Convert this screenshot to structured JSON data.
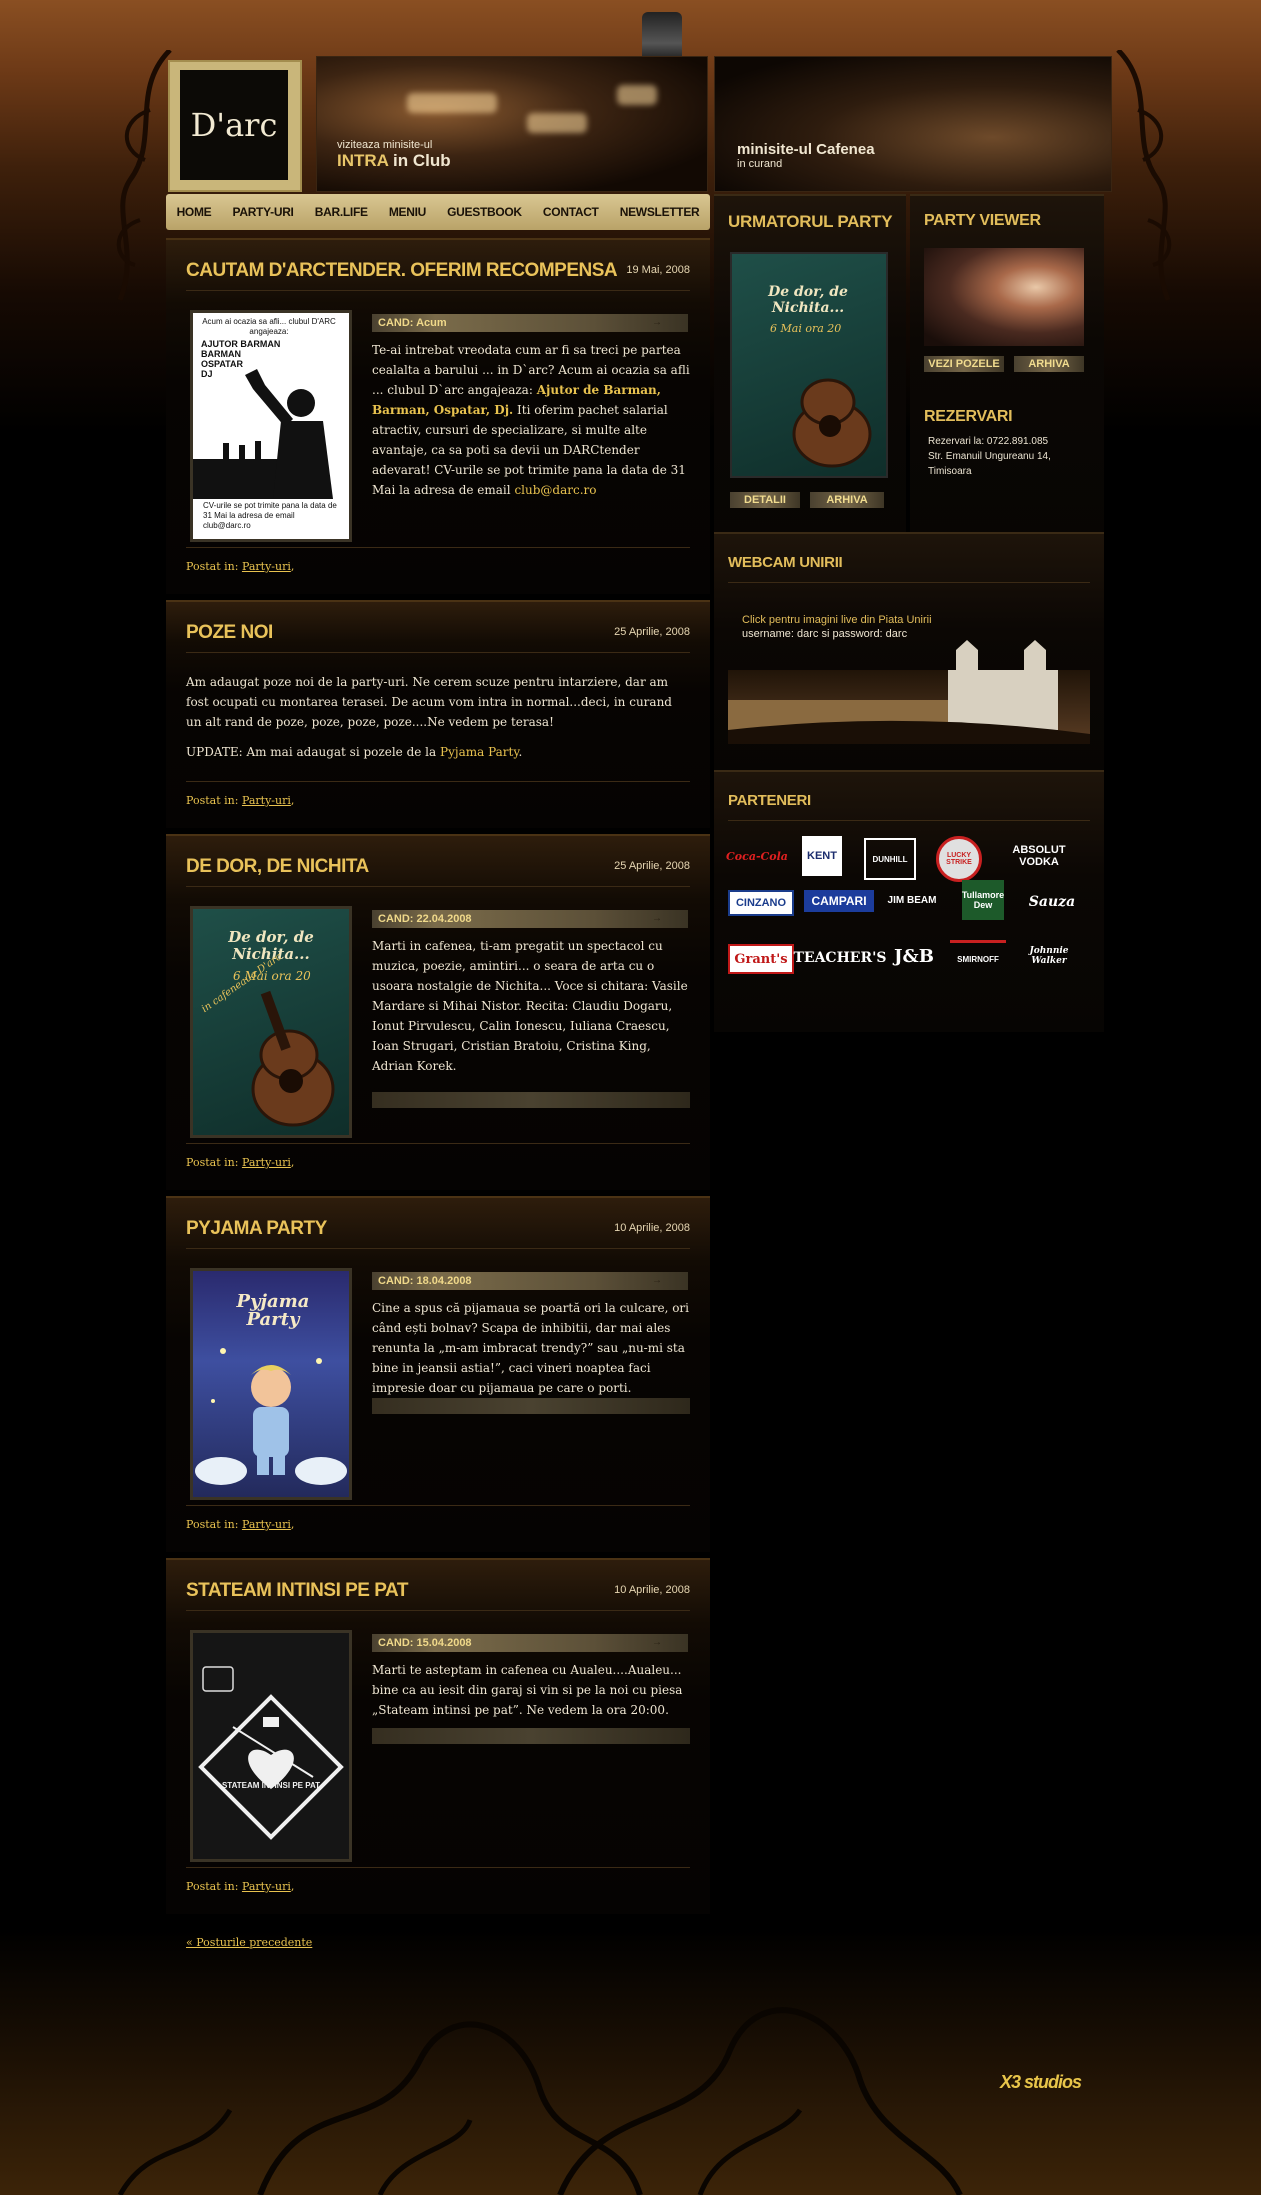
{
  "header": {
    "logo_text": "D'arc",
    "promo1_small": "viziteaza minisite-ul",
    "promo1_big": "INTRA",
    "promo1_suffix": "in Club",
    "promo2_big": "minisite-ul Cafenea",
    "promo2_small": "in curand"
  },
  "nav": [
    "HOME",
    "PARTY-URI",
    "BAR.LIFE",
    "MENIU",
    "GUESTBOOK",
    "CONTACT",
    "NEWSLETTER"
  ],
  "posts": [
    {
      "title": "CAUTAM D'ARCTENDER. OFERIM RECOMPENSA",
      "date": "19 Mai, 2008",
      "when": "CAND: Acum",
      "body_prefix": "Te-ai intrebat vreodata cum ar fi sa treci pe partea cealalta a barului ... in D`arc? Acum ai ocazia sa afli ... clubul D`arc angajeaza:",
      "body_bold": "Ajutor de Barman, Barman, Ospatar, Dj.",
      "body_suffix": "Iti oferim pachet salarial atractiv, cursuri de specializare, si multe alte avantaje, ca sa poti sa devii un DARCtender adevarat! CV-urile se pot trimite pana la data de 31 Mai la adresa de email",
      "email": "club@darc.ro",
      "poster_top": "Acum ai ocazia sa afli... clubul D'ARC angajeaza:",
      "poster_roles": [
        "AJUTOR BARMAN",
        "BARMAN",
        "OSPATAR",
        "DJ"
      ],
      "poster_bottom": "CV-urile se pot trimite pana la data de 31 Mai la adresa de email club@darc.ro",
      "posted_label": "Postat in:",
      "category": "Party-uri"
    },
    {
      "title": "POZE NOI",
      "date": "25 Aprilie, 2008",
      "body1": "Am adaugat poze noi de la party-uri. Ne cerem scuze pentru intarziere, dar am fost ocupati cu montarea terasei. De acum vom intra in normal...deci, in curand un alt rand de poze, poze, poze, poze....Ne vedem pe terasa!",
      "body2_prefix": "UPDATE: Am mai adaugat si pozele de la",
      "body2_link": "Pyjama Party",
      "posted_label": "Postat in:",
      "category": "Party-uri"
    },
    {
      "title": "DE DOR, DE NICHITA",
      "date": "25 Aprilie, 2008",
      "when": "CAND: 22.04.2008",
      "body": "Marti in cafenea, ti-am pregatit un spectacol cu muzica, poezie, amintiri... o seara de arta cu o usoara nostalgie de Nichita... Voce si chitara: Vasile Mardare si Mihai Nistor. Recita: Claudiu Dogaru, Ionut Pirvulescu, Calin Ionescu, Iuliana Craescu, Ioan Strugari, Cristian Bratoiu, Cristina King, Adrian Korek.",
      "poster_title": "De dor, de Nichita...",
      "poster_sub": "6 Mai ora 20",
      "poster_place": "in cafeneaua D'arc",
      "posted_label": "Postat in:",
      "category": "Party-uri"
    },
    {
      "title": "PYJAMA PARTY",
      "date": "10 Aprilie, 2008",
      "when": "CAND: 18.04.2008",
      "body": "Cine a spus că pijamaua se poartă ori la culcare, ori când ești bolnav? Scapa de inhibitii, dar mai ales renunta la „m-am imbracat trendy?” sau „nu-mi sta bine in jeansii astia!”, caci vineri noaptea faci impresie doar cu pijamaua pe care o porti.",
      "poster_title": "Pyjama Party",
      "posted_label": "Postat in:",
      "category": "Party-uri"
    },
    {
      "title": "STATEAM INTINSI PE PAT",
      "date": "10 Aprilie, 2008",
      "when": "CAND: 15.04.2008",
      "body": "Marti te asteptam in cafenea cu Aualeu....Aualeu... bine ca au iesit din garaj si vin si pe la noi cu piesa „Stateam intinsi pe pat”. Ne vedem la ora 20:00.",
      "poster_title": "STATEAM INTINSI PE PAT",
      "posted_label": "Postat in:",
      "category": "Party-uri"
    }
  ],
  "older_posts": "« Posturile precedente",
  "sidebar": {
    "next_party_title": "URMATORUL PARTY",
    "next_party_poster": "De dor, de Nichita...",
    "next_party_date": "6 Mai ora 20",
    "detalii": "DETALII",
    "arhiva": "ARHIVA",
    "viewer_title": "PARTY VIEWER",
    "vezi_pozele": "VEZI POZELE",
    "viewer_arhiva": "ARHIVA",
    "rezervari_title": "REZERVARI",
    "rezervari_phone": "Rezervari la: 0722.891.085",
    "rezervari_addr1": "Str. Emanuil Ungureanu 14,",
    "rezervari_addr2": "Timisoara",
    "webcam_title": "WEBCAM UNIRII",
    "webcam_line1": "Click pentru imagini live din Piata Unirii",
    "webcam_line2": "username: darc si password: darc",
    "partners_title": "PARTENERI",
    "partners": [
      "Coca-Cola",
      "KENT",
      "DUNHILL",
      "LUCKY STRIKE",
      "ABSOLUT VODKA",
      "CINZANO",
      "CAMPARI",
      "JIM BEAM",
      "Tullamore Dew",
      "Sauza",
      "Grant's",
      "TEACHER'S",
      "J&B",
      "SMIRNOFF",
      "Johnnie Walker"
    ]
  },
  "footer": {
    "studio": "X3 studios"
  },
  "colors": {
    "accent": "#e8c24f",
    "title": "#e9c25a",
    "nav_bg": "#d9c792",
    "background": "#000000"
  }
}
